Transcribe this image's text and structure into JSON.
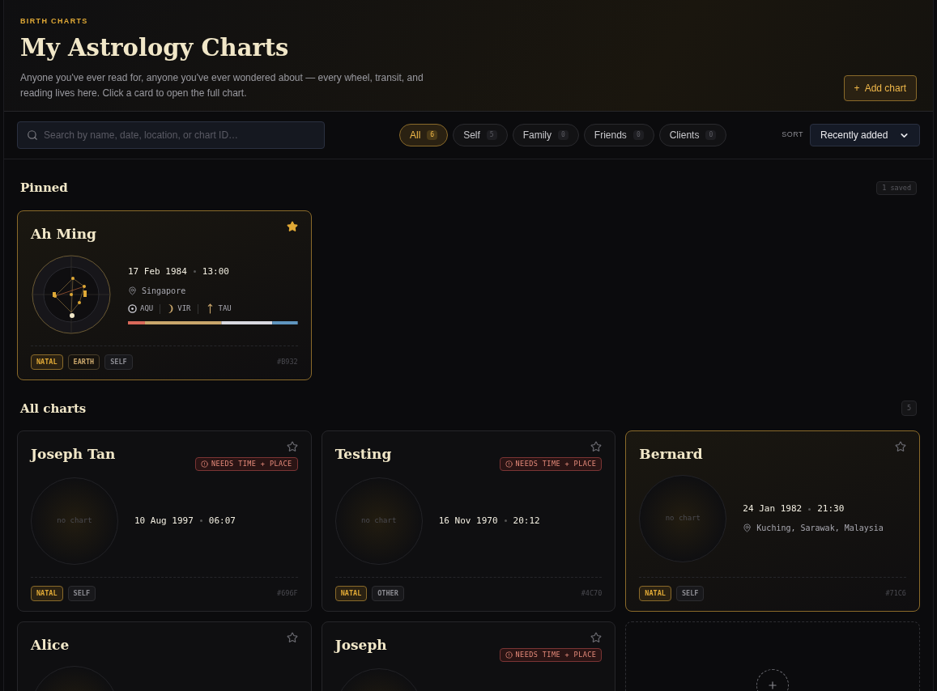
{
  "header": {
    "eyebrow": "BIRTH CHARTS",
    "title": "My Astrology Charts",
    "description": "Anyone you've ever read for, anyone you've ever wondered about — every wheel, transit, and reading lives here. Click a card to open the full chart.",
    "add_button": "Add chart",
    "add_icon": "+"
  },
  "toolbar": {
    "search": {
      "placeholder": "Search by name, date, location, or chart ID…"
    },
    "filters": [
      {
        "label": "All",
        "count": "6",
        "selected": true
      },
      {
        "label": "Self",
        "count": "5",
        "selected": false
      },
      {
        "label": "Family",
        "count": "0",
        "selected": false
      },
      {
        "label": "Friends",
        "count": "0",
        "selected": false
      },
      {
        "label": "Clients",
        "count": "0",
        "selected": false
      }
    ],
    "sort_label": "SORT",
    "sort_value": "Recently added"
  },
  "pinned": {
    "title": "Pinned",
    "count": "1 saved",
    "cards": [
      {
        "name": "Ah Ming",
        "starred": true,
        "selected": true,
        "kind": "wheel",
        "date": "17 Feb 1984",
        "time": "13:00",
        "location": "Singapore",
        "signs": [
          {
            "kind": "sun",
            "label": "AQU"
          },
          {
            "kind": "moon",
            "label": "VIR"
          },
          {
            "kind": "rising",
            "label": "TAU"
          }
        ],
        "balance": {
          "kind": "element-bar"
        },
        "tags": [
          {
            "kind": "type",
            "label": "NATAL"
          },
          {
            "kind": "element",
            "label": "EARTH"
          },
          {
            "kind": "group",
            "label": "SELF"
          }
        ],
        "id": "#B932"
      }
    ]
  },
  "all": {
    "title": "All charts",
    "count": "5",
    "cards": [
      {
        "name": "Joseph Tan",
        "starred": false,
        "selected": false,
        "warning": "NEEDS TIME + PLACE",
        "kind": "empty",
        "empty_label": "no chart",
        "date": "10 Aug 1997",
        "time": "06:07",
        "tags": [
          {
            "kind": "type",
            "label": "NATAL"
          },
          {
            "kind": "group",
            "label": "SELF"
          }
        ],
        "id": "#696F"
      },
      {
        "name": "Testing",
        "starred": false,
        "selected": false,
        "warning": "NEEDS TIME + PLACE",
        "kind": "empty",
        "empty_label": "no chart",
        "date": "16 Nov 1970",
        "time": "20:12",
        "tags": [
          {
            "kind": "type",
            "label": "NATAL"
          },
          {
            "kind": "group",
            "label": "OTHER"
          }
        ],
        "id": "#4C70"
      },
      {
        "name": "Bernard",
        "starred": false,
        "selected": true,
        "kind": "empty",
        "empty_label": "no chart",
        "date": "24 Jan 1982",
        "time": "21:30",
        "location": "Kuching, Sarawak, Malaysia",
        "tags": [
          {
            "kind": "type",
            "label": "NATAL"
          },
          {
            "kind": "group",
            "label": "SELF"
          }
        ],
        "id": "#71C6"
      },
      {
        "name": "Alice",
        "starred": false,
        "selected": false,
        "kind": "empty"
      },
      {
        "name": "Joseph",
        "starred": false,
        "selected": false,
        "warning": "NEEDS TIME + PLACE",
        "kind": "empty"
      }
    ],
    "add_card": {
      "kind": "add"
    }
  }
}
